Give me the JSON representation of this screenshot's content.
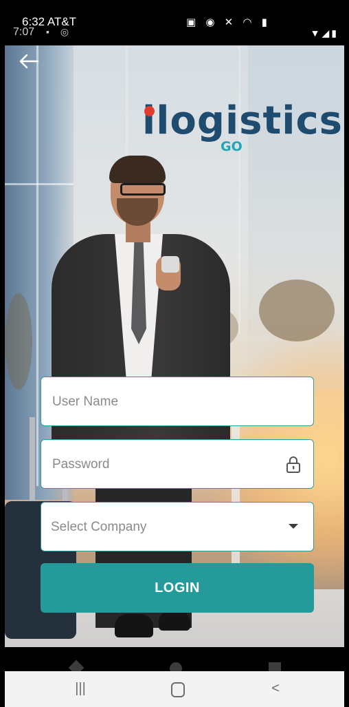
{
  "status_bar": {
    "outer_time": "6:32 AT&T",
    "inner_time": "7:07"
  },
  "brand": {
    "logo_text": "logistics",
    "logo_i": "i",
    "logo_sub": "GO",
    "dark_color": "#1e4b6e",
    "accent_color": "#22a6b3",
    "dot_color": "#e23a2e"
  },
  "form": {
    "username_placeholder": "User Name",
    "password_placeholder": "Password",
    "company_placeholder": "Select Company",
    "login_label": "LOGIN",
    "accent_color": "#249a9a"
  },
  "icons": {
    "back": "back-arrow-icon",
    "lock": "lock-icon",
    "dropdown": "dropdown-caret-icon",
    "nav_recents": "recents-icon",
    "nav_home": "home-icon",
    "nav_back": "back-icon"
  },
  "nav": {
    "recents_glyph": "|||",
    "back_glyph": "<"
  }
}
